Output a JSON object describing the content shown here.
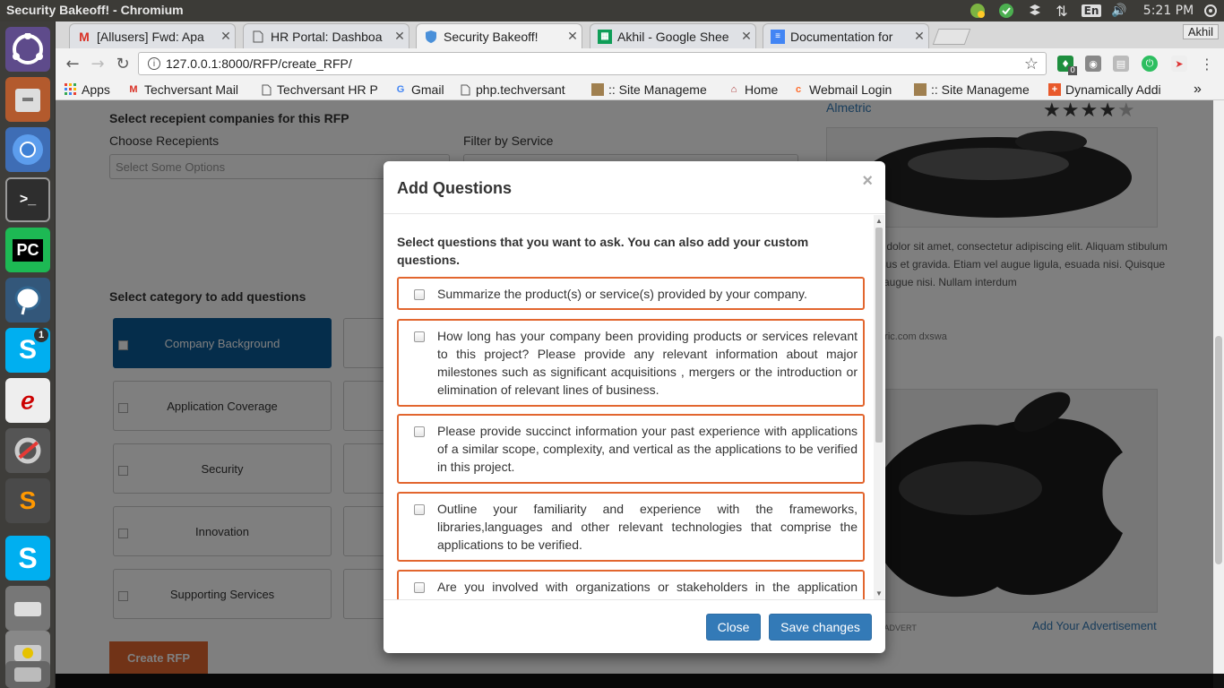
{
  "window": {
    "title": "Security Bakeoff! - Chromium"
  },
  "system_tray": {
    "language": "En",
    "time": "5:21 PM",
    "skype_badge": "1"
  },
  "tabs": [
    {
      "label": "[Allusers] Fwd: Apa",
      "icon": "gmail-icon",
      "active": false
    },
    {
      "label": "HR Portal: Dashboa",
      "icon": "page-icon",
      "active": false
    },
    {
      "label": "Security Bakeoff!",
      "icon": "shield-icon",
      "active": true
    },
    {
      "label": "Akhil - Google Shee",
      "icon": "sheets-icon",
      "active": false
    },
    {
      "label": "Documentation for",
      "icon": "docs-icon",
      "active": false
    }
  ],
  "user_badge": "Akhil",
  "address": {
    "url": "127.0.0.1:8000/RFP/create_RFP/"
  },
  "extensions": {
    "badge_count": "0"
  },
  "bookmarks": [
    {
      "label": "Apps",
      "icon": "apps-grid-icon"
    },
    {
      "label": "Techversant Mail",
      "icon": "gmail-icon"
    },
    {
      "label": "Techversant HR P",
      "icon": "page-icon"
    },
    {
      "label": "Gmail",
      "icon": "google-icon"
    },
    {
      "label": "php.techversant",
      "icon": "page-icon"
    },
    {
      "label": ":: Site Manageme",
      "icon": "site-icon"
    },
    {
      "label": "Home",
      "icon": "home-icon"
    },
    {
      "label": "Webmail Login",
      "icon": "cpanel-icon"
    },
    {
      "label": ":: Site Manageme",
      "icon": "site-icon"
    },
    {
      "label": "Dynamically Addi",
      "icon": "plus-icon"
    }
  ],
  "bookmarks_more": "»",
  "background": {
    "recipients_heading": "Select recepient companies for this RFP",
    "choose_recipients_label": "Choose Recepients",
    "filter_label": "Filter by Service",
    "select_placeholder": "Select Some Options",
    "category_heading": "Select category to add questions",
    "categories": [
      {
        "label": "Company Background",
        "selected": true
      },
      {
        "label": "Application Coverage",
        "selected": false
      },
      {
        "label": "Security",
        "selected": false
      },
      {
        "label": "Innovation",
        "selected": false
      },
      {
        "label": "Supporting Services",
        "selected": false
      }
    ],
    "create_button": "Create RFP",
    "sidebar": {
      "company_name": "Almetric",
      "rating": 4,
      "rating_max": 5,
      "lorem": "m dolor sit amet, consectetur adipiscing elit. Aliquam stibulum risus et gravida. Etiam vel augue ligula, esuada nisi. Quisque a augue nisi. Nullam interdum",
      "links": "etric.com  dxswa",
      "advert_label": "D ADVERT",
      "add_advert": "Add Your Advertisement"
    }
  },
  "modal": {
    "title": "Add Questions",
    "close_glyph": "×",
    "intro": "Select questions that you want to ask. You can also add your custom questions.",
    "questions": [
      "Summarize the product(s) or service(s) provided by your company.",
      "How long has your company been providing products or services relevant to this project? Please provide any relevant information about major milestones such as significant acquisitions , mergers or the introduction or elimination of relevant lines of business.",
      "Please provide succinct information your past experience with applications of a similar scope, complexity, and vertical as the applications to be verified in this project.",
      "Outline your familiarity and experience with the frameworks, libraries,languages and other relevant technologies that comprise the applications to be verified.",
      "Are you involved with organizations or stakeholders in the application security community such as the Open Web Application Security Project"
    ],
    "close_button": "Close",
    "save_button": "Save changes"
  },
  "colors": {
    "accent_orange": "#e2662f",
    "primary_blue": "#337ab7",
    "selected_category": "#0b5a96",
    "ubuntu_panel": "#3c3b37"
  }
}
